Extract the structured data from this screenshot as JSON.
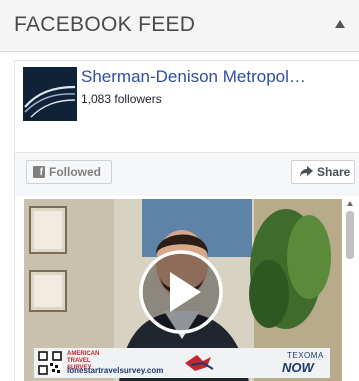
{
  "widget": {
    "title": "FACEBOOK FEED"
  },
  "page": {
    "name": "Sherman-Denison Metropol…",
    "followers": "1,083 followers"
  },
  "actions": {
    "followed_label": "Followed",
    "share_label": "Share"
  },
  "video": {
    "banner_org": "AMERICAN TRAVEL SURVEY",
    "banner_url": "lonestartravelsurvey.com",
    "banner_brand_top": "TEXOMA",
    "banner_brand_bottom": "NOW"
  },
  "colors": {
    "link": "#2f4f9c",
    "header_bg": "#f5f5f5",
    "action_bar_bg": "#f6f7f9"
  }
}
